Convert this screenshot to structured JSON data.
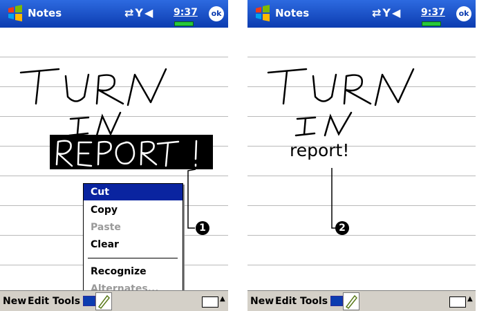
{
  "left": {
    "titlebar": {
      "app_name": "Notes",
      "clock": "9:37",
      "ok_label": "ok"
    },
    "ink_words": [
      "TURN",
      "IN",
      "REPORT!"
    ],
    "context_menu": {
      "items": [
        {
          "label": "Cut",
          "state": "selected"
        },
        {
          "label": "Copy",
          "state": "enabled"
        },
        {
          "label": "Paste",
          "state": "disabled"
        },
        {
          "label": "Clear",
          "state": "enabled"
        },
        {
          "label": "Recognize",
          "state": "enabled"
        },
        {
          "label": "Alternates...",
          "state": "disabled"
        }
      ]
    },
    "callout": "1",
    "menubar": {
      "new_label": "New",
      "edit_label": "Edit",
      "tools_label": "Tools"
    }
  },
  "right": {
    "titlebar": {
      "app_name": "Notes",
      "clock": "9:37",
      "ok_label": "ok"
    },
    "ink_words": [
      "TURN",
      "IN"
    ],
    "recognized_text": "report!",
    "callout": "2",
    "menubar": {
      "new_label": "New",
      "edit_label": "Edit",
      "tools_label": "Tools"
    }
  },
  "colors": {
    "titlebar": "#0c3cb0",
    "selection": "#0a24a0",
    "battery": "#27c83b",
    "menubar": "#d4d0c8"
  },
  "icons": [
    "windows-start-icon",
    "connectivity-icon",
    "signal-off-icon",
    "speaker-icon",
    "keyboard-icon",
    "pen-icon",
    "scroll-up-icon",
    "scroll-down-icon"
  ]
}
